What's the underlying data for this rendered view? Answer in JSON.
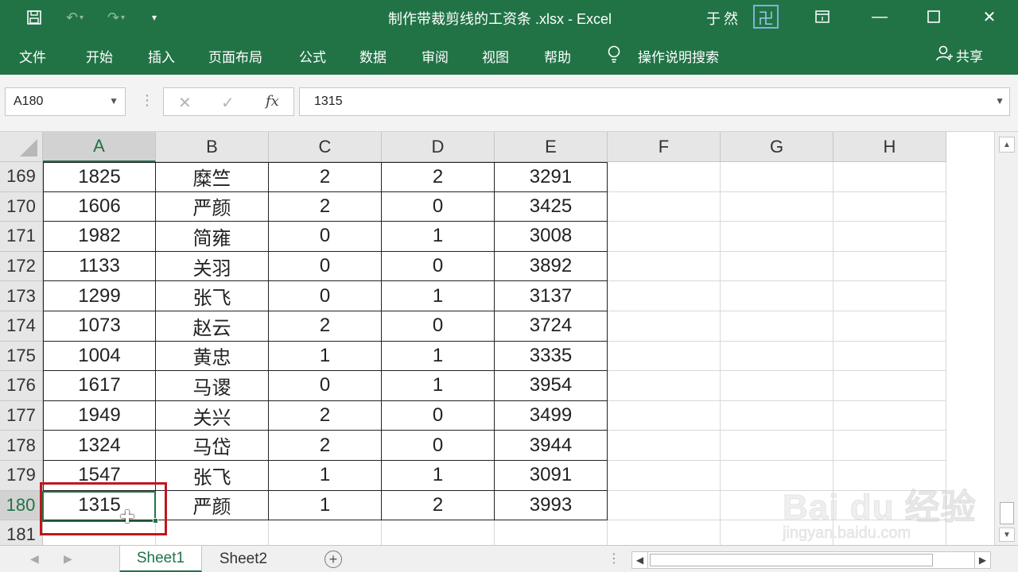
{
  "titlebar": {
    "title": "制作带裁剪线的工资条 .xlsx  -  Excel",
    "user": "于然",
    "avatar_glyph": "卍"
  },
  "ribbon_tabs": [
    "文件",
    "开始",
    "插入",
    "页面布局",
    "公式",
    "数据",
    "审阅",
    "视图",
    "帮助"
  ],
  "tell_me": "操作说明搜索",
  "share": "共享",
  "namebox": "A180",
  "formula": "1315",
  "columns": [
    "A",
    "B",
    "C",
    "D",
    "E",
    "F",
    "G",
    "H"
  ],
  "rows": [
    {
      "num": "169",
      "a": "1825",
      "b": "糜竺",
      "c": "2",
      "d": "2",
      "e": "3291"
    },
    {
      "num": "170",
      "a": "1606",
      "b": "严颜",
      "c": "2",
      "d": "0",
      "e": "3425"
    },
    {
      "num": "171",
      "a": "1982",
      "b": "简雍",
      "c": "0",
      "d": "1",
      "e": "3008"
    },
    {
      "num": "172",
      "a": "1133",
      "b": "关羽",
      "c": "0",
      "d": "0",
      "e": "3892"
    },
    {
      "num": "173",
      "a": "1299",
      "b": "张飞",
      "c": "0",
      "d": "1",
      "e": "3137"
    },
    {
      "num": "174",
      "a": "1073",
      "b": "赵云",
      "c": "2",
      "d": "0",
      "e": "3724"
    },
    {
      "num": "175",
      "a": "1004",
      "b": "黄忠",
      "c": "1",
      "d": "1",
      "e": "3335"
    },
    {
      "num": "176",
      "a": "1617",
      "b": "马谡",
      "c": "0",
      "d": "1",
      "e": "3954"
    },
    {
      "num": "177",
      "a": "1949",
      "b": "关兴",
      "c": "2",
      "d": "0",
      "e": "3499"
    },
    {
      "num": "178",
      "a": "1324",
      "b": "马岱",
      "c": "2",
      "d": "0",
      "e": "3944"
    },
    {
      "num": "179",
      "a": "1547",
      "b": "张飞",
      "c": "1",
      "d": "1",
      "e": "3091"
    },
    {
      "num": "180",
      "a": "1315",
      "b": "严颜",
      "c": "1",
      "d": "2",
      "e": "3993"
    },
    {
      "num": "181",
      "a": "",
      "b": "",
      "c": "",
      "d": "",
      "e": ""
    }
  ],
  "active_cell": "A180",
  "sheets": [
    "Sheet1",
    "Sheet2"
  ],
  "active_sheet": "Sheet1",
  "watermark": {
    "brand": "Bai du 经验",
    "url": "jingyan.baidu.com"
  },
  "colors": {
    "accent": "#217346",
    "highlight": "#c0161e"
  }
}
